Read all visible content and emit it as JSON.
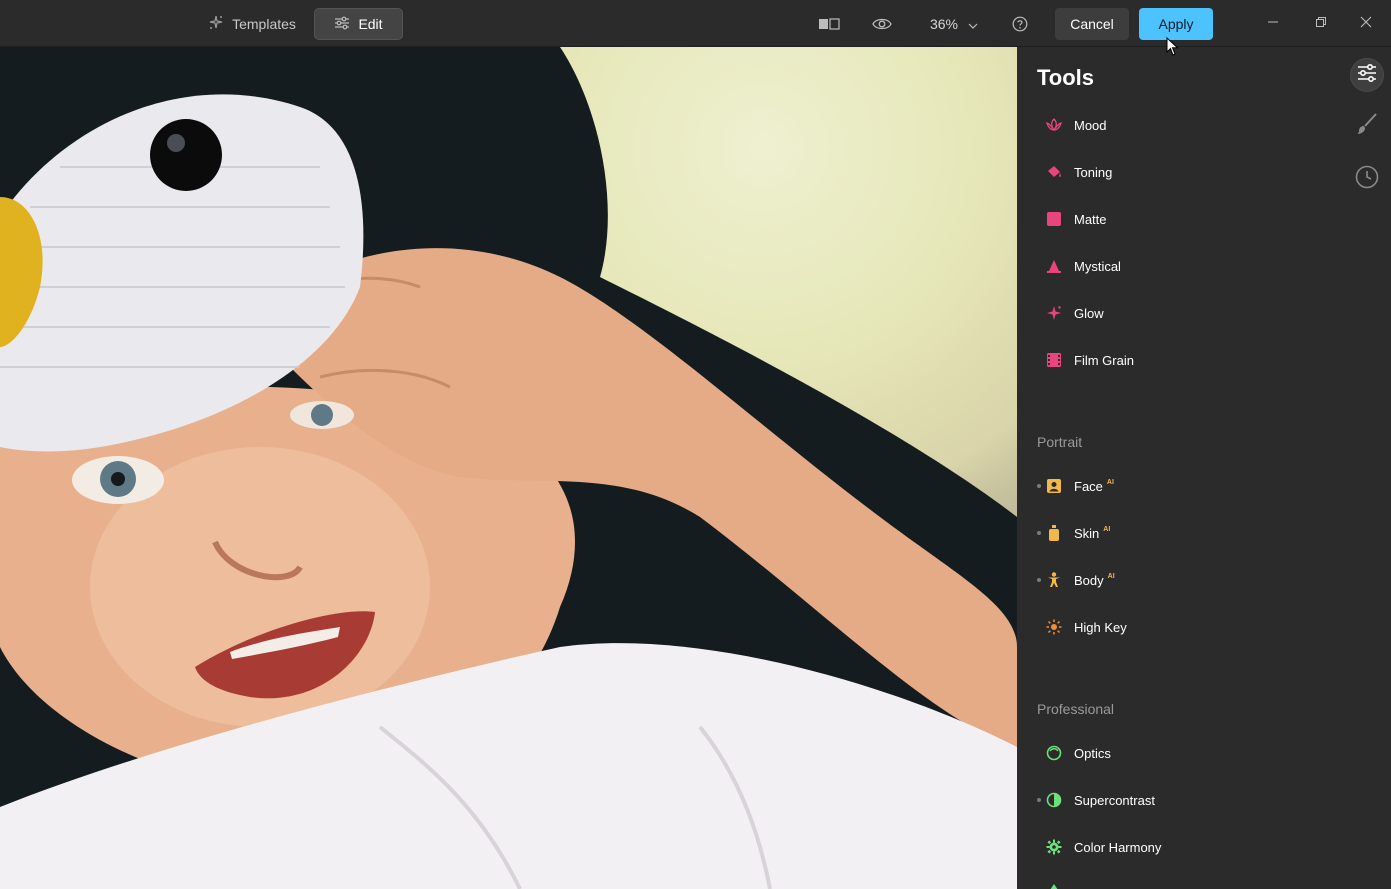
{
  "topbar": {
    "templates_label": "Templates",
    "edit_label": "Edit",
    "zoom_value": "36%",
    "cancel_label": "Cancel",
    "apply_label": "Apply"
  },
  "panel": {
    "title": "Tools",
    "tools": [
      {
        "label": "Mood",
        "icon": "lotus-icon",
        "color": "#e8457f"
      },
      {
        "label": "Toning",
        "icon": "paint-bucket-icon",
        "color": "#e8457f"
      },
      {
        "label": "Matte",
        "icon": "square-icon",
        "color": "#e8457f"
      },
      {
        "label": "Mystical",
        "icon": "cone-icon",
        "color": "#e8457f"
      },
      {
        "label": "Glow",
        "icon": "sparkle-icon",
        "color": "#e8457f"
      },
      {
        "label": "Film Grain",
        "icon": "film-icon",
        "color": "#e8457f"
      }
    ],
    "portrait_label": "Portrait",
    "portrait": [
      {
        "label": "Face",
        "badge": "AI",
        "icon": "face-frame-icon",
        "color": "#f2b84b"
      },
      {
        "label": "Skin",
        "badge": "AI",
        "icon": "bottle-icon",
        "color": "#f2b84b"
      },
      {
        "label": "Body",
        "badge": "AI",
        "icon": "person-icon",
        "color": "#f2b84b"
      },
      {
        "label": "High Key",
        "icon": "sun-icon",
        "color": "#f28c3a"
      }
    ],
    "professional_label": "Professional",
    "professional": [
      {
        "label": "Optics",
        "icon": "lens-icon",
        "color": "#6ee07a"
      },
      {
        "label": "Supercontrast",
        "icon": "half-circle-icon",
        "color": "#6ee07a"
      },
      {
        "label": "Color Harmony",
        "icon": "gear-icon",
        "color": "#6ee07a"
      }
    ]
  }
}
